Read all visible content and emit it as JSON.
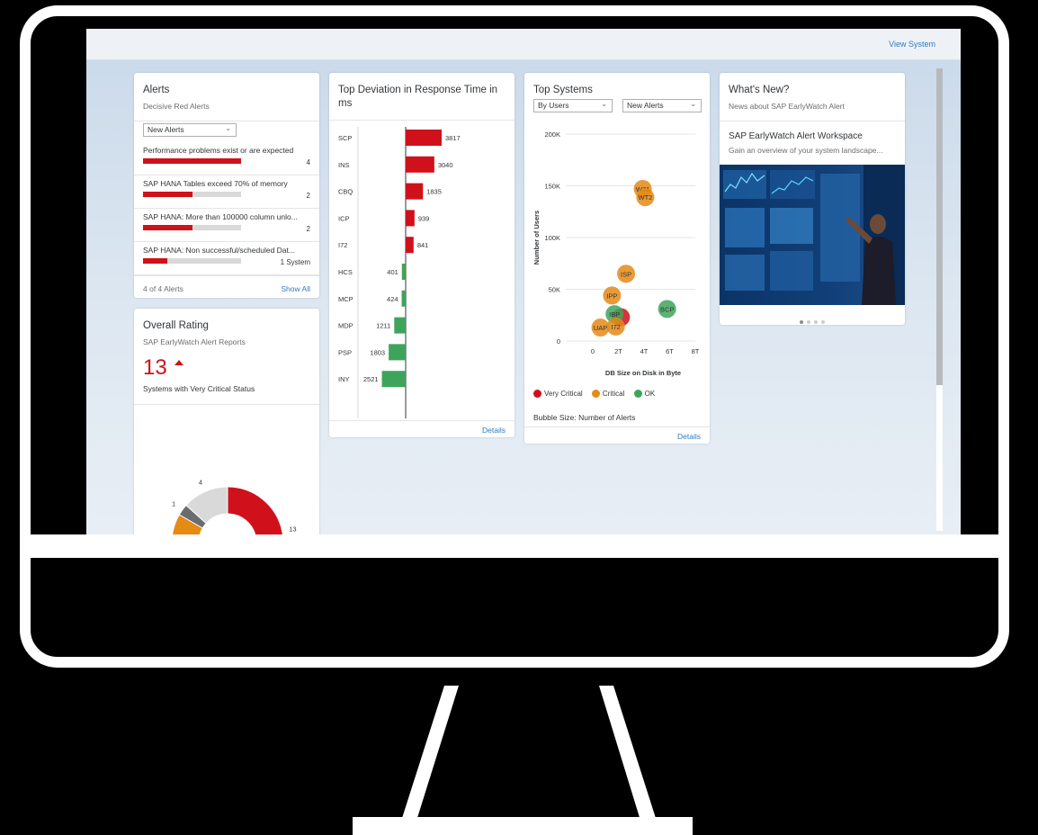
{
  "header": {
    "view_system": "View System"
  },
  "alerts": {
    "title": "Alerts",
    "subtitle": "Decisive Red Alerts",
    "filter": "New Alerts",
    "items": [
      {
        "text": "Performance problems exist or are expected",
        "count": "4",
        "fill": 1.0
      },
      {
        "text": "SAP HANA Tables exceed 70% of memory",
        "count": "2",
        "fill": 0.5
      },
      {
        "text": "SAP HANA: More than 100000 column unlo...",
        "count": "2",
        "fill": 0.5
      },
      {
        "text": "SAP HANA: Non successful/scheduled Dat...",
        "count": "1 System",
        "fill": 0.25
      }
    ],
    "footer_count": "4 of 4 Alerts",
    "show_all": "Show All"
  },
  "rating": {
    "title": "Overall Rating",
    "subtitle": "SAP EarlyWatch Alert Reports",
    "value": "13",
    "caption": "Systems with Very Critical Status",
    "donut": [
      {
        "label": "13",
        "value": 13,
        "color": "#d0111b"
      },
      {
        "label": "",
        "value": 12,
        "color": "#e48a15"
      },
      {
        "label": "1",
        "value": 1,
        "color": "#6a6d70"
      },
      {
        "label": "4",
        "value": 4,
        "color": "#d9d9d9"
      }
    ]
  },
  "deviation": {
    "title": "Top Deviation in Response Time in ms",
    "details": "Details"
  },
  "top_systems": {
    "title": "Top Systems",
    "filter1": "By Users",
    "filter2": "New Alerts",
    "bubble_size": "Bubble Size: Number of Alerts",
    "details": "Details",
    "legend": [
      "Very Critical",
      "Critical",
      "OK"
    ]
  },
  "whats_new": {
    "title": "What's New?",
    "subtitle": "News about SAP EarlyWatch Alert",
    "item_title": "SAP EarlyWatch Alert Workspace",
    "item_desc": "Gain an overview of your system landscape..."
  },
  "chart_data": [
    {
      "type": "bar",
      "title": "Top Deviation in Response Time in ms",
      "categories": [
        "SCP",
        "INS",
        "CBQ",
        "ICP",
        "I72",
        "HCS",
        "MCP",
        "MDP",
        "PSP",
        "INY"
      ],
      "values": [
        3817,
        3040,
        1835,
        939,
        841,
        -401,
        -424,
        -1211,
        -1803,
        -2521
      ],
      "labels": [
        "3817",
        "3040",
        "1835",
        "939",
        "841",
        "401",
        "424",
        "1211",
        "1803",
        "2521"
      ],
      "colors": [
        "#d0111b",
        "#d0111b",
        "#d0111b",
        "#d0111b",
        "#d0111b",
        "#3fa45b",
        "#3fa45b",
        "#3fa45b",
        "#3fa45b",
        "#3fa45b"
      ]
    },
    {
      "type": "scatter",
      "title": "Top Systems",
      "xlabel": "DB Size on Disk in Byte",
      "ylabel": "Number of Users",
      "x_ticks": [
        "0",
        "2T",
        "4T",
        "6T",
        "8T"
      ],
      "y_ticks": [
        "0",
        "50K",
        "100K",
        "150K",
        "200K"
      ],
      "xlim": [
        0,
        8
      ],
      "ylim": [
        0,
        200000
      ],
      "points": [
        {
          "label": "W71",
          "x": 3.9,
          "y": 147000,
          "status": "Critical"
        },
        {
          "label": "WT2",
          "x": 4.1,
          "y": 139000,
          "status": "Critical"
        },
        {
          "label": "ISP",
          "x": 2.6,
          "y": 65000,
          "status": "Critical"
        },
        {
          "label": "IPP",
          "x": 1.5,
          "y": 44000,
          "status": "Critical"
        },
        {
          "label": "BCP",
          "x": 5.8,
          "y": 31000,
          "status": "OK"
        },
        {
          "label": "",
          "x": 2.2,
          "y": 23000,
          "status": "Very Critical"
        },
        {
          "label": "IBP",
          "x": 1.7,
          "y": 26000,
          "status": "OK"
        },
        {
          "label": "UAP",
          "x": 0.6,
          "y": 13000,
          "status": "Critical"
        },
        {
          "label": "I72",
          "x": 1.8,
          "y": 14000,
          "status": "Critical"
        }
      ],
      "status_colors": {
        "Very Critical": "#d0111b",
        "Critical": "#e48a15",
        "OK": "#3fa45b"
      }
    }
  ]
}
